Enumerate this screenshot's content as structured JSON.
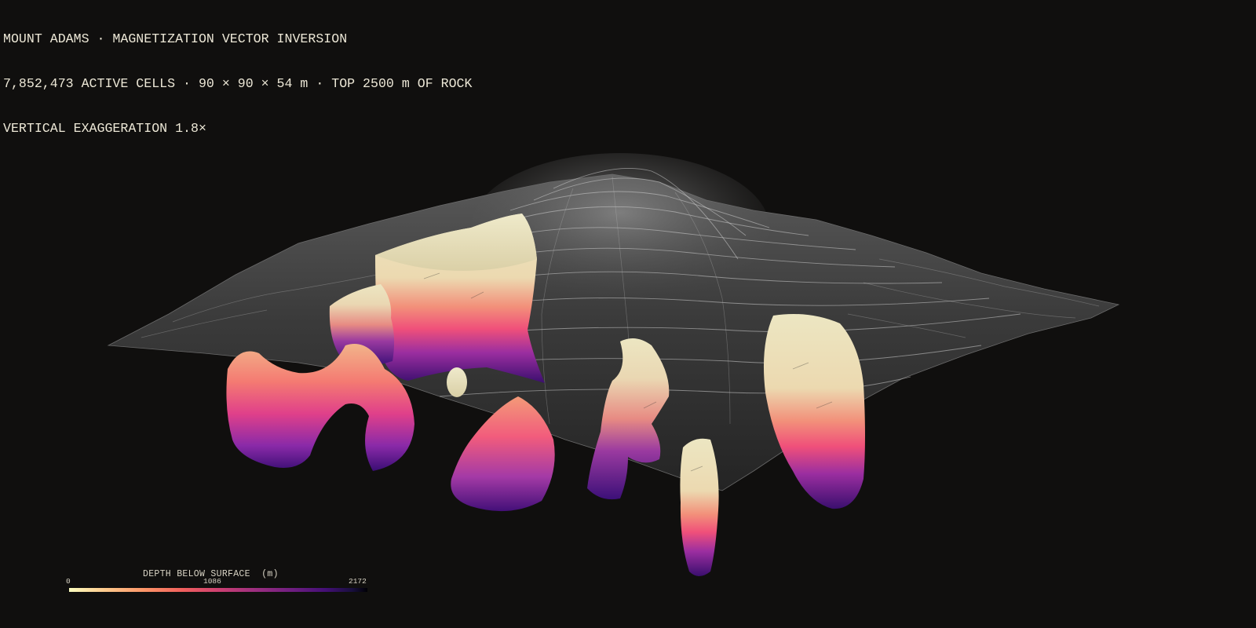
{
  "header": {
    "line1": "MOUNT ADAMS · MAGNETIZATION VECTOR INVERSION",
    "line2": "7,852,473 ACTIVE CELLS · 90 × 90 × 54 m · TOP 2500 m OF ROCK",
    "line3": "VERTICAL EXAGGERATION 1.8×"
  },
  "legend": {
    "title": "DEPTH BELOW SURFACE  (m)",
    "tick_min": "0",
    "tick_mid": "1086",
    "tick_max": "2172",
    "colormap": [
      "#fcfdbf",
      "#feca8d",
      "#fd9668",
      "#f1605d",
      "#cd4071",
      "#9e2f7f",
      "#721f81",
      "#440f76",
      "#180f3d",
      "#000004"
    ]
  },
  "colors": {
    "background": "#100f0e",
    "terrain": "#3a3a3a",
    "contour": "#bdbdbd",
    "body_top": "#ece6c2"
  }
}
